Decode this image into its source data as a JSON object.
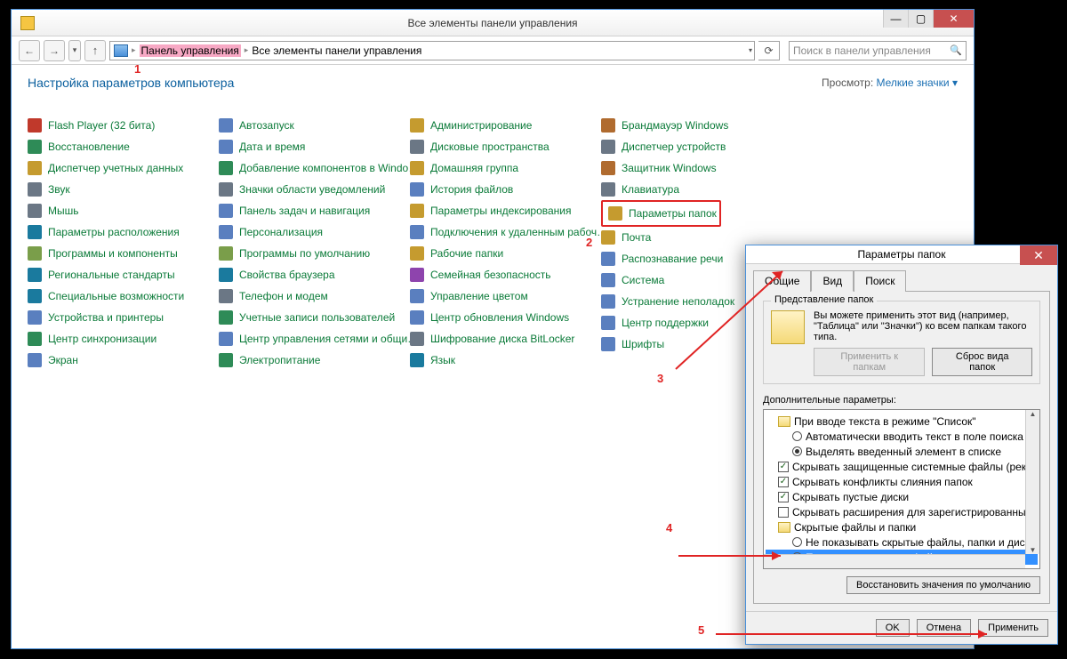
{
  "window": {
    "title": "Все элементы панели управления",
    "breadcrumb_root": "Панель управления",
    "breadcrumb_current": "Все элементы панели управления",
    "search_placeholder": "Поиск в панели управления"
  },
  "page": {
    "heading": "Настройка параметров компьютера",
    "view_label": "Просмотр:",
    "view_value": "Мелкие значки ▾"
  },
  "cols": [
    [
      {
        "label": "Flash Player (32 бита)",
        "color": "#c0392b"
      },
      {
        "label": "Восстановление",
        "color": "#2e8b57"
      },
      {
        "label": "Диспетчер учетных данных",
        "color": "#c59b2f"
      },
      {
        "label": "Звук",
        "color": "#6b7785"
      },
      {
        "label": "Мышь",
        "color": "#6b7785"
      },
      {
        "label": "Параметры расположения",
        "color": "#1a7a9e"
      },
      {
        "label": "Программы и компоненты",
        "color": "#7a9e4a"
      },
      {
        "label": "Региональные стандарты",
        "color": "#1a7a9e"
      },
      {
        "label": "Специальные возможности",
        "color": "#1a7a9e"
      },
      {
        "label": "Устройства и принтеры",
        "color": "#5a7fbf"
      },
      {
        "label": "Центр синхронизации",
        "color": "#2e8b57"
      },
      {
        "label": "Экран",
        "color": "#5a7fbf"
      }
    ],
    [
      {
        "label": "Автозапуск",
        "color": "#5a7fbf"
      },
      {
        "label": "Дата и время",
        "color": "#5a7fbf"
      },
      {
        "label": "Добавление компонентов в Windo…",
        "color": "#2e8b57"
      },
      {
        "label": "Значки области уведомлений",
        "color": "#6b7785"
      },
      {
        "label": "Панель задач и навигация",
        "color": "#5a7fbf"
      },
      {
        "label": "Персонализация",
        "color": "#5a7fbf"
      },
      {
        "label": "Программы по умолчанию",
        "color": "#7a9e4a"
      },
      {
        "label": "Свойства браузера",
        "color": "#1a7a9e"
      },
      {
        "label": "Телефон и модем",
        "color": "#6b7785"
      },
      {
        "label": "Учетные записи пользователей",
        "color": "#2e8b57"
      },
      {
        "label": "Центр управления сетями и общи…",
        "color": "#5a7fbf"
      },
      {
        "label": "Электропитание",
        "color": "#2e8b57"
      }
    ],
    [
      {
        "label": "Администрирование",
        "color": "#c59b2f"
      },
      {
        "label": "Дисковые пространства",
        "color": "#6b7785"
      },
      {
        "label": "Домашняя группа",
        "color": "#c59b2f"
      },
      {
        "label": "История файлов",
        "color": "#5a7fbf"
      },
      {
        "label": "Параметры индексирования",
        "color": "#c59b2f"
      },
      {
        "label": "Подключения к удаленным рабоч…",
        "color": "#5a7fbf"
      },
      {
        "label": "Рабочие папки",
        "color": "#c59b2f"
      },
      {
        "label": "Семейная безопасность",
        "color": "#8e44ad"
      },
      {
        "label": "Управление цветом",
        "color": "#5a7fbf"
      },
      {
        "label": "Центр обновления Windows",
        "color": "#5a7fbf"
      },
      {
        "label": "Шифрование диска BitLocker",
        "color": "#6b7785"
      },
      {
        "label": "Язык",
        "color": "#1a7a9e"
      }
    ],
    [
      {
        "label": "Брандмауэр Windows",
        "color": "#b06b2f"
      },
      {
        "label": "Диспетчер устройств",
        "color": "#6b7785"
      },
      {
        "label": "Защитник Windows",
        "color": "#b06b2f"
      },
      {
        "label": "Клавиатура",
        "color": "#6b7785"
      },
      {
        "label": "Параметры папок",
        "color": "#c59b2f",
        "highlight": true
      },
      {
        "label": "Почта",
        "color": "#c59b2f"
      },
      {
        "label": "Распознавание речи",
        "color": "#5a7fbf"
      },
      {
        "label": "Система",
        "color": "#5a7fbf"
      },
      {
        "label": "Устранение неполадок",
        "color": "#5a7fbf"
      },
      {
        "label": "Центр поддержки",
        "color": "#5a7fbf"
      },
      {
        "label": "Шрифты",
        "color": "#5a7fbf"
      }
    ]
  ],
  "dialog": {
    "title": "Параметры папок",
    "tabs": {
      "general": "Общие",
      "view": "Вид",
      "search": "Поиск"
    },
    "group_title": "Представление папок",
    "group_text": "Вы можете применить этот вид (например, \"Таблица\" или \"Значки\") ко всем папкам такого типа.",
    "apply_folders": "Применить к папкам",
    "reset_folders": "Сброс вида папок",
    "advanced_label": "Дополнительные параметры:",
    "tree": [
      {
        "type": "folder",
        "indent": 1,
        "label": "При вводе текста в режиме \"Список\""
      },
      {
        "type": "radio",
        "indent": 2,
        "sel": false,
        "label": "Автоматически вводить текст в поле поиска"
      },
      {
        "type": "radio",
        "indent": 2,
        "sel": true,
        "label": "Выделять введенный элемент в списке"
      },
      {
        "type": "check",
        "indent": 1,
        "checked": true,
        "label": "Скрывать защищенные системные файлы (рекомен."
      },
      {
        "type": "check",
        "indent": 1,
        "checked": true,
        "label": "Скрывать конфликты слияния папок"
      },
      {
        "type": "check",
        "indent": 1,
        "checked": true,
        "label": "Скрывать пустые диски"
      },
      {
        "type": "check",
        "indent": 1,
        "checked": false,
        "label": "Скрывать расширения для зарегистрированных типо"
      },
      {
        "type": "folder",
        "indent": 1,
        "label": "Скрытые файлы и папки"
      },
      {
        "type": "radio",
        "indent": 2,
        "sel": false,
        "label": "Не показывать скрытые файлы, папки и диски"
      },
      {
        "type": "radio",
        "indent": 2,
        "sel": true,
        "selected_row": true,
        "label": "Показывать скрытые файлы, папки и диски"
      }
    ],
    "restore": "Восстановить значения по умолчанию",
    "ok": "OK",
    "cancel": "Отмена",
    "apply": "Применить"
  },
  "annotations": {
    "n1": "1",
    "n2": "2",
    "n3": "3",
    "n4": "4",
    "n5": "5"
  }
}
